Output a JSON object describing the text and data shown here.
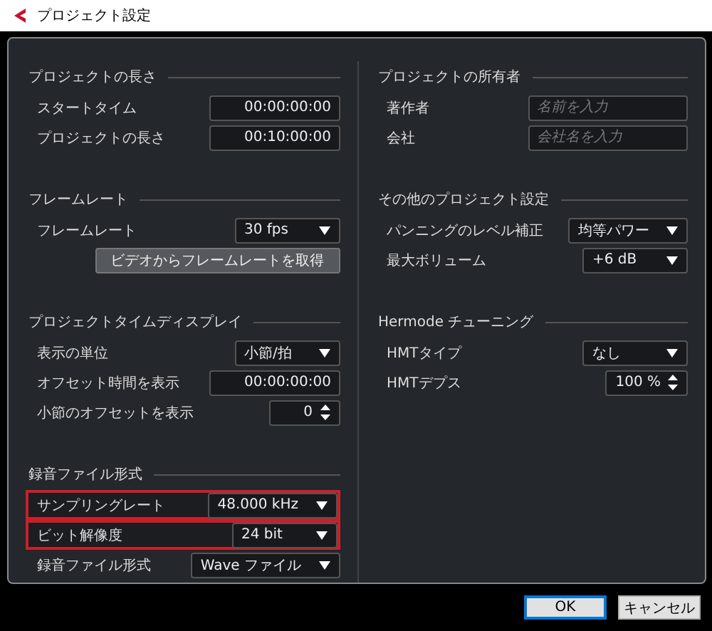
{
  "window": {
    "title": "プロジェクト設定"
  },
  "columns": [
    {
      "sections": [
        {
          "title": "プロジェクトの長さ",
          "rows": [
            {
              "kind": "field",
              "label": "スタートタイム",
              "value": "00:00:00:00",
              "highlighted": false
            },
            {
              "kind": "field",
              "label": "プロジェクトの長さ",
              "value": "00:10:00:00",
              "highlighted": false
            }
          ]
        },
        {
          "title": "フレームレート",
          "rows": [
            {
              "kind": "dropdown",
              "label": "フレームレート",
              "value": "30 fps",
              "highlighted": false
            },
            {
              "kind": "button",
              "value": "ビデオからフレームレートを取得",
              "highlighted": false
            }
          ]
        },
        {
          "title": "プロジェクトタイムディスプレイ",
          "rows": [
            {
              "kind": "dropdown",
              "label": "表示の単位",
              "value": "小節/拍",
              "highlighted": false
            },
            {
              "kind": "field",
              "label": "オフセット時間を表示",
              "value": "00:00:00:00",
              "highlighted": false
            },
            {
              "kind": "spinner",
              "label": "小節のオフセットを表示",
              "value": "0",
              "highlighted": false
            }
          ]
        },
        {
          "title": "録音ファイル形式",
          "rows": [
            {
              "kind": "dropdown",
              "label": "サンプリングレート",
              "value": "48.000 kHz",
              "highlighted": true
            },
            {
              "kind": "dropdown",
              "label": "ビット解像度",
              "value": "24 bit",
              "highlighted": true
            },
            {
              "kind": "dropdown",
              "label": "録音ファイル形式",
              "value": "Wave ファイル",
              "highlighted": false
            }
          ]
        }
      ]
    },
    {
      "sections": [
        {
          "title": "プロジェクトの所有者",
          "rows": [
            {
              "kind": "field",
              "label": "著作者",
              "placeholder": "名前を入力",
              "highlighted": false
            },
            {
              "kind": "field",
              "label": "会社",
              "placeholder": "会社名を入力",
              "highlighted": false
            }
          ]
        },
        {
          "title": "その他のプロジェクト設定",
          "rows": [
            {
              "kind": "dropdown",
              "label": "パンニングのレベル補正",
              "value": "均等パワー",
              "highlighted": false
            },
            {
              "kind": "dropdown",
              "label": "最大ボリューム",
              "value": "+6 dB",
              "highlighted": false
            }
          ]
        },
        {
          "title": "Hermode チューニング",
          "rows": [
            {
              "kind": "dropdown",
              "label": "HMTタイプ",
              "value": "なし",
              "highlighted": false
            },
            {
              "kind": "spinner",
              "label": "HMTデプス",
              "value": "100 %",
              "highlighted": false
            }
          ]
        }
      ]
    }
  ],
  "buttons": [
    {
      "label": "OK",
      "selected": true
    },
    {
      "label": "キャンセル",
      "selected": false
    }
  ]
}
